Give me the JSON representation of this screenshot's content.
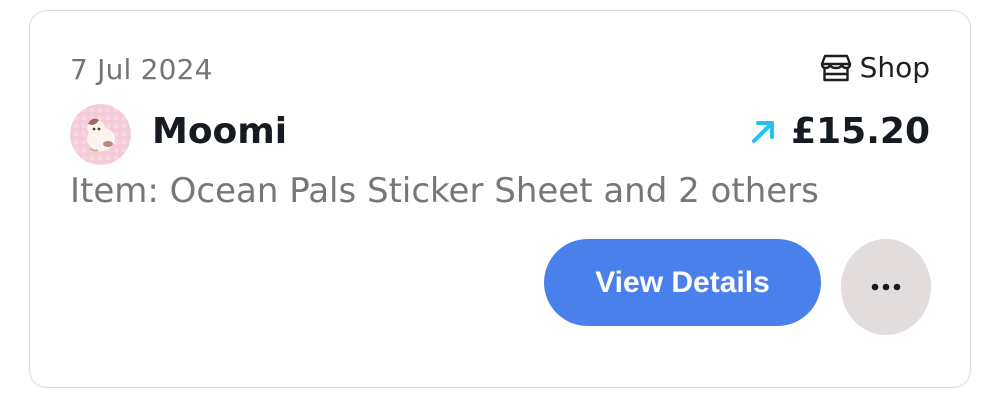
{
  "transaction": {
    "date": "7 Jul 2024",
    "source_label": "Shop",
    "source_icon": "shop-icon",
    "seller_name": "Moomi",
    "avatar_icon": "avatar",
    "direction_icon": "arrow-up-right-icon",
    "amount": "£15.20",
    "item_description": "Item: Ocean Pals Sticker Sheet and 2 others"
  },
  "actions": {
    "view_details_label": "View Details",
    "more_icon": "more-horizontal-icon"
  },
  "colors": {
    "primary_button": "#4a80ec",
    "arrow_accent": "#23c2ef",
    "more_button_bg": "#e3dcdc",
    "avatar_bg": "#f6d2dc"
  }
}
